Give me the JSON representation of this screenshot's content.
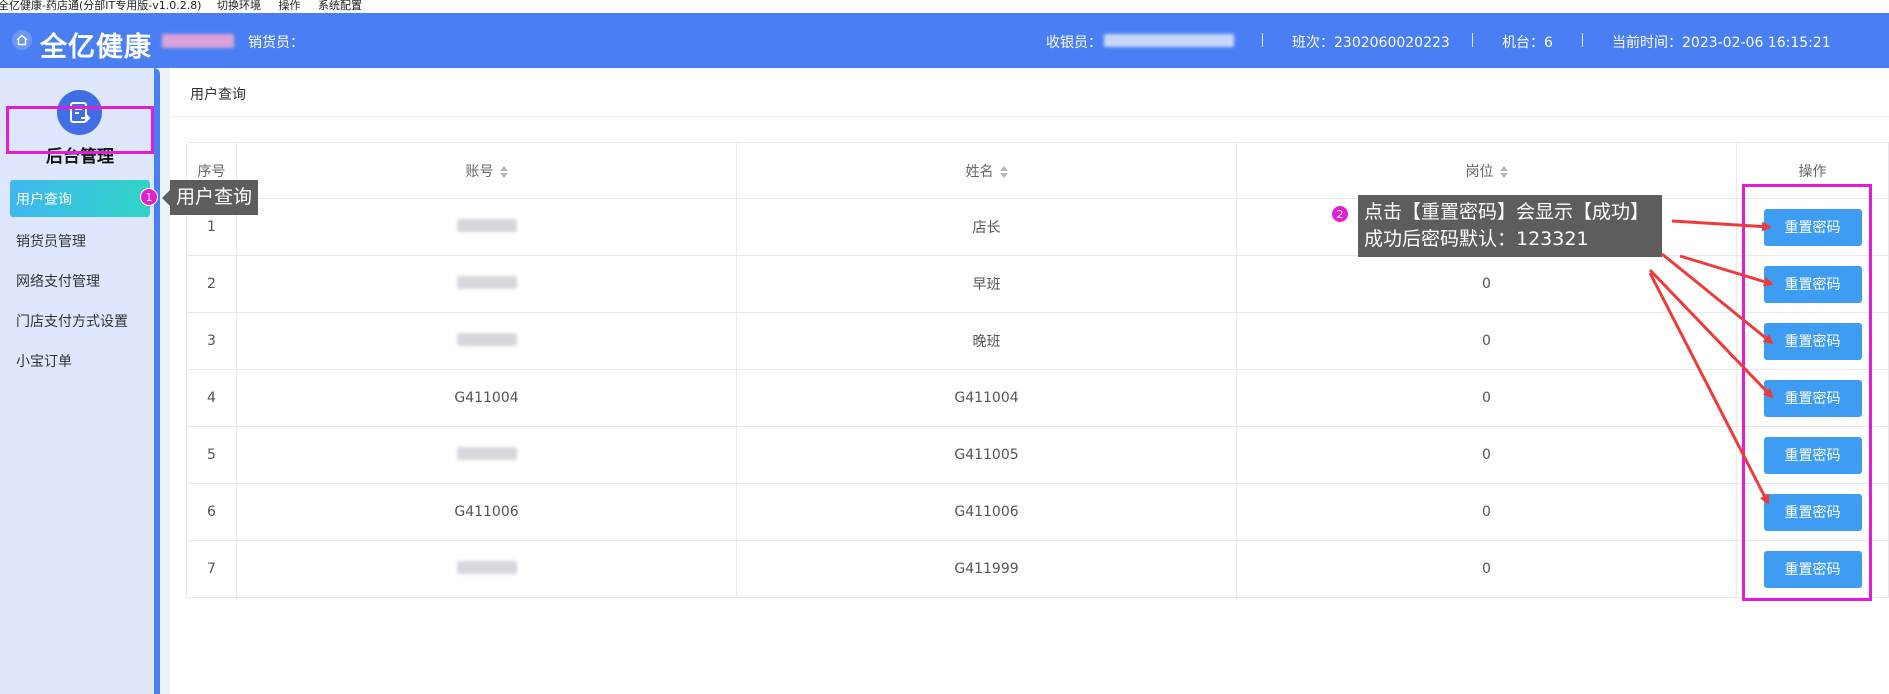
{
  "window": {
    "title": "全亿健康-药店通(分部IT专用版-v1.0.2.8)",
    "menu": [
      "切换环境",
      "操作",
      "系统配置"
    ]
  },
  "header": {
    "brand": "全亿健康",
    "seller_label": "销货员：",
    "cashier_label": "收银员：",
    "shift": "班次：2302060020223",
    "register": "机台：6",
    "current_time": "当前时间：2023-02-06 16:15:21",
    "icon": "home-icon"
  },
  "sidebar": {
    "title": "后台管理",
    "icon": "admin-logo-icon",
    "items": [
      {
        "label": "用户查询",
        "active": true
      },
      {
        "label": "销货员管理"
      },
      {
        "label": "网络支付管理"
      },
      {
        "label": "门店支付方式设置"
      },
      {
        "label": "小宝订单"
      }
    ]
  },
  "main": {
    "breadcrumb": "用户查询",
    "table": {
      "columns": [
        "序号",
        "账号",
        "姓名",
        "岗位",
        "操作"
      ],
      "rows": [
        {
          "index": "1",
          "account": "",
          "name": "店长",
          "position": "",
          "action": "重置密码"
        },
        {
          "index": "2",
          "account": "",
          "name": "早班",
          "position": "0",
          "action": "重置密码"
        },
        {
          "index": "3",
          "account": "",
          "name": "晚班",
          "position": "0",
          "action": "重置密码"
        },
        {
          "index": "4",
          "account": "G411004",
          "name": "G411004",
          "position": "0",
          "action": "重置密码"
        },
        {
          "index": "5",
          "account": "",
          "name": "G411005",
          "position": "0",
          "action": "重置密码"
        },
        {
          "index": "6",
          "account": "G411006",
          "name": "G411006",
          "position": "0",
          "action": "重置密码"
        },
        {
          "index": "7",
          "account": "",
          "name": "G411999",
          "position": "0",
          "action": "重置密码"
        }
      ]
    }
  },
  "annotations": {
    "step1_number": "1",
    "step1_text": "用户查询",
    "step2_number": "2",
    "step2_line1": "点击【重置密码】会显示【成功】",
    "step2_line2": "成功后密码默认：123321",
    "highlight_color": "#e31dd6",
    "arrow_color": "#f03a3a"
  }
}
